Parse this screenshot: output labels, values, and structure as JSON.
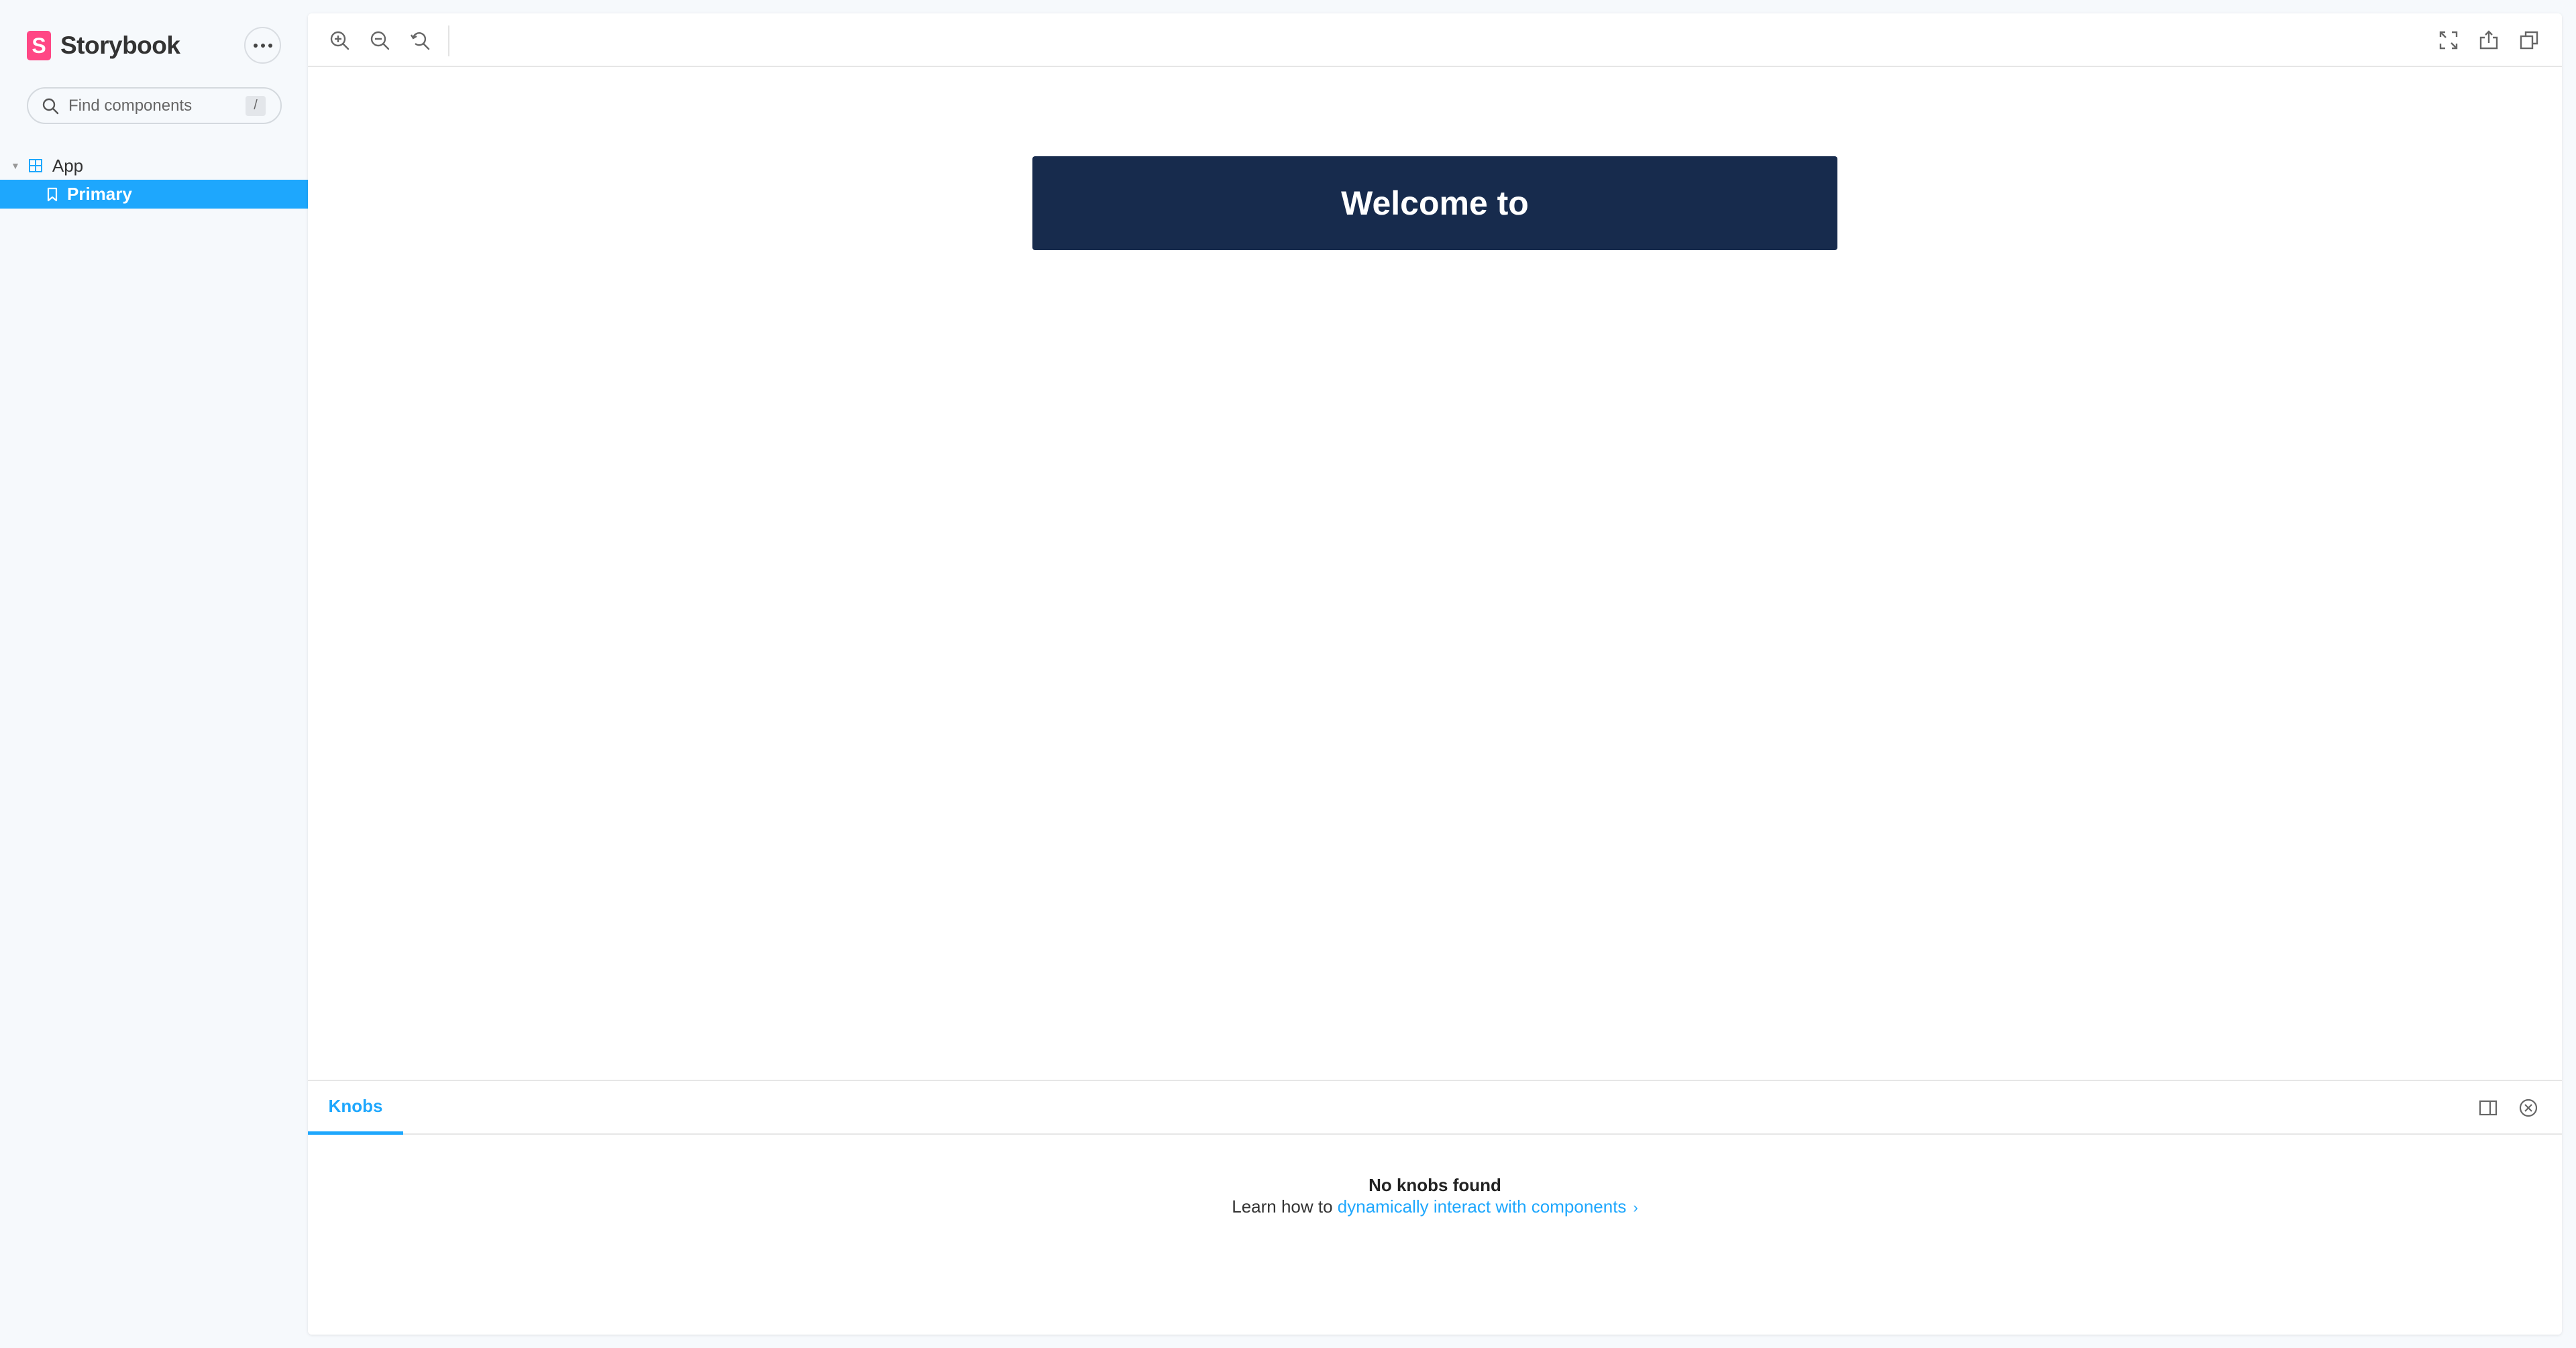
{
  "app": {
    "logo_letter": "S",
    "name": "Storybook",
    "accent_color": "#1EA7FD",
    "brand_color": "#FF4785"
  },
  "sidebar": {
    "menu_icon": "ellipsis-icon",
    "search": {
      "placeholder": "Find components",
      "shortcut": "/"
    },
    "tree": {
      "group_label": "App",
      "group_icon": "component-icon",
      "items": [
        {
          "label": "Primary",
          "icon": "bookmark-icon",
          "selected": true
        }
      ]
    }
  },
  "toolbar": {
    "left_tools": [
      "zoom-in-icon",
      "zoom-out-icon",
      "zoom-reset-icon"
    ],
    "right_tools": [
      "fullscreen-icon",
      "share-icon",
      "copy-icon"
    ]
  },
  "preview": {
    "banner_text": "Welcome to",
    "banner_color": "#172B4D"
  },
  "addons": {
    "tabs": [
      {
        "label": "Knobs",
        "active": true
      }
    ],
    "empty_title": "No knobs found",
    "empty_prefix": "Learn how to ",
    "empty_link": "dynamically interact with components",
    "empty_chevron": "›"
  }
}
